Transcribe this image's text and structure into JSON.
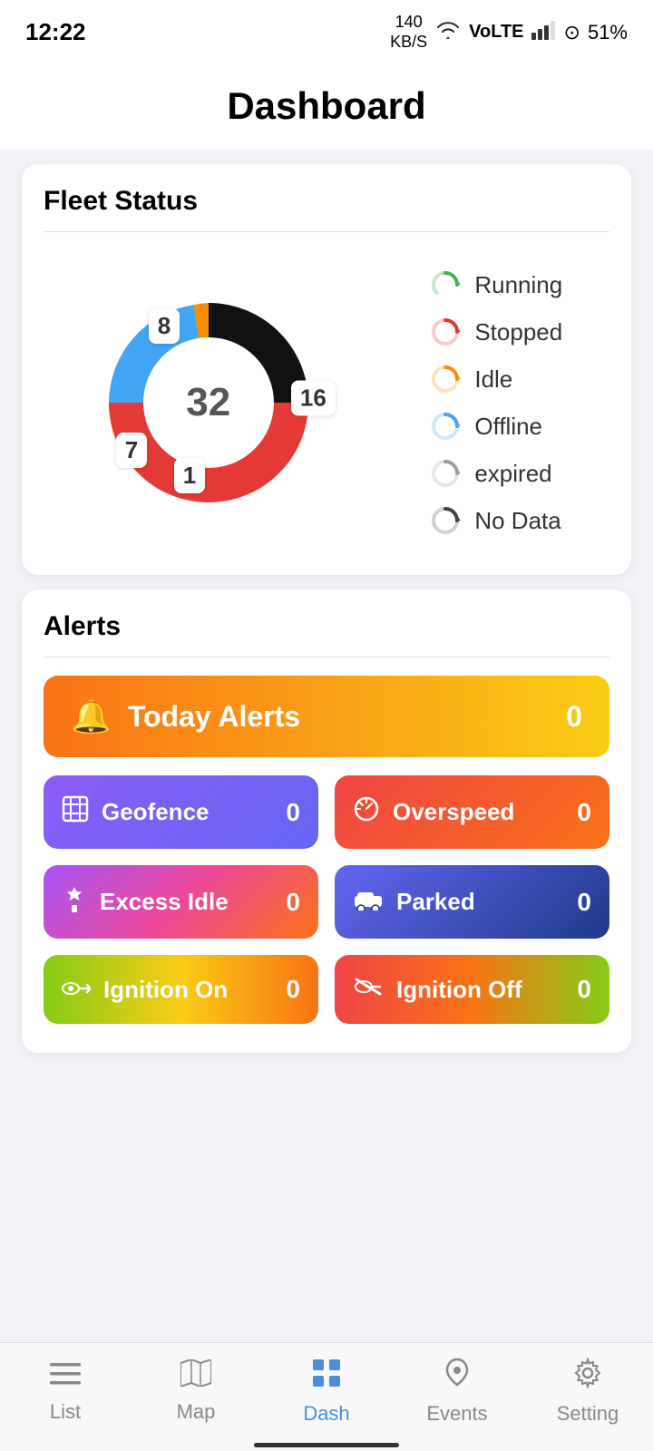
{
  "statusBar": {
    "time": "12:22",
    "data": "140\nKB/S",
    "battery": "51%"
  },
  "header": {
    "title": "Dashboard"
  },
  "fleetStatus": {
    "title": "Fleet Status",
    "total": "32",
    "segments": [
      {
        "label": "8",
        "position": "top",
        "color": "#111"
      },
      {
        "label": "16",
        "position": "right",
        "color": "#e53935"
      },
      {
        "label": "7",
        "position": "bottom-left",
        "color": "#4fc3f7"
      },
      {
        "label": "1",
        "position": "bottom-center",
        "color": "#fb8c00"
      }
    ],
    "legend": [
      {
        "name": "Running",
        "color": "#4caf50"
      },
      {
        "name": "Stopped",
        "color": "#e53935"
      },
      {
        "name": "Idle",
        "color": "#fb8c00"
      },
      {
        "name": "Offline",
        "color": "#4fc3f7"
      },
      {
        "name": "expired",
        "color": "#9e9e9e"
      },
      {
        "name": "No Data",
        "color": "#424242"
      }
    ]
  },
  "alerts": {
    "title": "Alerts",
    "today": {
      "label": "Today Alerts",
      "count": "0"
    },
    "items": [
      {
        "id": "geofence",
        "label": "Geofence",
        "count": "0",
        "icon": "⊞",
        "colorClass": "geofence"
      },
      {
        "id": "overspeed",
        "label": "Overspeed",
        "count": "0",
        "icon": "⊘",
        "colorClass": "overspeed"
      },
      {
        "id": "excess-idle",
        "label": "Excess Idle",
        "count": "0",
        "icon": "🔔",
        "colorClass": "excess-idle"
      },
      {
        "id": "parked",
        "label": "Parked",
        "count": "0",
        "icon": "🚌",
        "colorClass": "parked"
      },
      {
        "id": "ignition-on",
        "label": "Ignition On",
        "count": "0",
        "icon": "🔑",
        "colorClass": "ignition-on"
      },
      {
        "id": "ignition-off",
        "label": "Ignition Off",
        "count": "0",
        "icon": "✂",
        "colorClass": "ignition-off"
      }
    ]
  },
  "nav": {
    "items": [
      {
        "id": "list",
        "label": "List",
        "icon": "≡",
        "active": false
      },
      {
        "id": "map",
        "label": "Map",
        "icon": "⊡",
        "active": false
      },
      {
        "id": "dash",
        "label": "Dash",
        "icon": "⊞",
        "active": true
      },
      {
        "id": "events",
        "label": "Events",
        "icon": "🔔",
        "active": false
      },
      {
        "id": "setting",
        "label": "Setting",
        "icon": "⚙",
        "active": false
      }
    ]
  }
}
